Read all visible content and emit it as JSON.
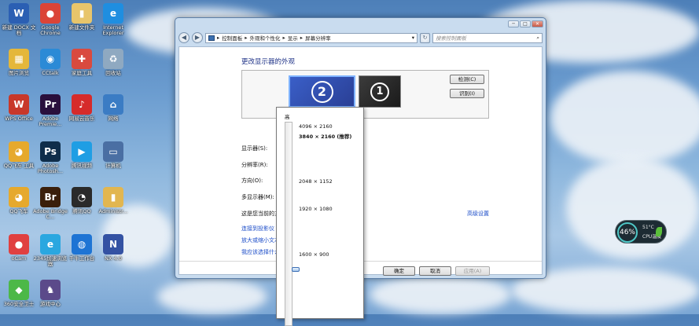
{
  "desktop": {
    "icons": [
      {
        "label": "新建 DOCX 文档",
        "glyph": "W",
        "color": "#2b5fb3"
      },
      {
        "label": "Google Chrome",
        "glyph": "●",
        "color": "#db4437"
      },
      {
        "label": "新建文件夹",
        "glyph": "▮",
        "color": "#e8c56b"
      },
      {
        "label": "Internet Explorer",
        "glyph": "e",
        "color": "#1f8ee0"
      },
      {
        "label": "图片浏览",
        "glyph": "▦",
        "color": "#e4b73a"
      },
      {
        "label": "CCtalk",
        "glyph": "◉",
        "color": "#2b8ad6"
      },
      {
        "label": "家庭工具",
        "glyph": "✚",
        "color": "#d94a3f"
      },
      {
        "label": "回收站",
        "glyph": "♻",
        "color": "#8fa9c1"
      },
      {
        "label": "WPS Office",
        "glyph": "W",
        "color": "#c8382a"
      },
      {
        "label": "Adobe Premie...",
        "glyph": "Pr",
        "color": "#2a0f3d"
      },
      {
        "label": "网易云音乐",
        "glyph": "♪",
        "color": "#d62b2b"
      },
      {
        "label": "网络",
        "glyph": "⌂",
        "color": "#3b7cc4"
      },
      {
        "label": "QQ飞车 工具",
        "glyph": "◕",
        "color": "#e6a92d"
      },
      {
        "label": "Adobe Photosh...",
        "glyph": "Ps",
        "color": "#0f2d4a"
      },
      {
        "label": "腾讯视频",
        "glyph": "▶",
        "color": "#1f9ee4"
      },
      {
        "label": "计算机",
        "glyph": "▭",
        "color": "#4a6fa3"
      },
      {
        "label": "QQ飞车",
        "glyph": "◕",
        "color": "#e6a92d"
      },
      {
        "label": "Adobe Bridge C...",
        "glyph": "Br",
        "color": "#3a1f0b"
      },
      {
        "label": "腾讯QQ",
        "glyph": "◔",
        "color": "#2a2a2a"
      },
      {
        "label": "Administr...",
        "glyph": "▮",
        "color": "#e2b650"
      },
      {
        "label": "oCam",
        "glyph": "●",
        "color": "#e04040"
      },
      {
        "label": "2345加速浏览器",
        "glyph": "e",
        "color": "#2aa7e0"
      },
      {
        "label": "千牛工作台",
        "glyph": "◍",
        "color": "#1e74d4"
      },
      {
        "label": "NX 4.0",
        "glyph": "N",
        "color": "#3452a3"
      },
      {
        "label": "360安全卫士",
        "glyph": "◆",
        "color": "#4cb848"
      },
      {
        "label": "游戏中心",
        "glyph": "♞",
        "color": "#5b4a8a"
      }
    ]
  },
  "window": {
    "minimize": "─",
    "maximize": "□",
    "close": "✕",
    "back": "◀",
    "forward": "▶",
    "breadcrumb": [
      "控制面板",
      "外观和个性化",
      "显示",
      "屏幕分辨率"
    ],
    "breadcrumb_sep": "▸",
    "refresh": "↻",
    "search_placeholder": "搜索控制面板",
    "search_icon": "⌕",
    "heading": "更改显示器的外观",
    "monitor2": "2",
    "monitor1": "1",
    "detect_button": "检测(C)",
    "identify_button": "识别(I)",
    "labels": {
      "display": "显示器(S):",
      "resolution": "分辨率(R):",
      "orientation": "方向(O):",
      "multiple": "多显示器(M):",
      "primary": "这是您当前的主"
    },
    "advanced_link": "高级设置",
    "links": [
      "连接到投影仪 (",
      "放大或缩小文本",
      "我应该选择什么"
    ],
    "ok_button": "确定",
    "cancel_button": "取消",
    "apply_button": "应用(A)"
  },
  "resolution_popup": {
    "top_label": "高",
    "options": [
      {
        "label": "4096 × 2160",
        "bold": false
      },
      {
        "label": "3840 × 2160 (推荐)",
        "bold": true
      },
      {
        "label": "2048 × 1152",
        "bold": false
      },
      {
        "label": "1920 × 1080",
        "bold": false
      },
      {
        "label": "1600 × 900",
        "bold": false
      }
    ],
    "selected_fraction": 0.7
  },
  "gadget": {
    "cpu_percent": "46%",
    "temp": "51°C",
    "label": "CPU温度"
  }
}
